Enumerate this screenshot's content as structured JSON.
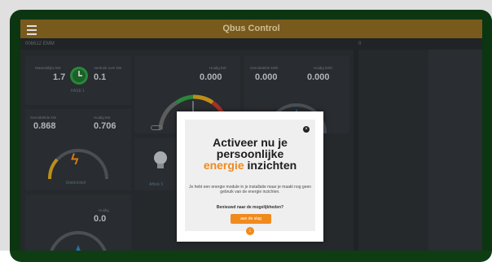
{
  "colors": {
    "accent": "#f08a1c",
    "topbar": "#8a6722",
    "frame": "#0e3d14",
    "app_bg": "#2c2f33"
  },
  "header": {
    "title": "Qbus Control",
    "menu_icon": "menu-icon"
  },
  "subbar": {
    "device": "006612 EMM",
    "right_id": "0"
  },
  "widgets": {
    "w1": {
      "label_a": "Maandelijks kW",
      "value_a": "1.7",
      "label_b": "Verbruik over kW",
      "value_b": "0.1",
      "phase": "FASE 1",
      "icon": "clock-icon"
    },
    "w2": {
      "label": "Huidig kW",
      "value": "0.000"
    },
    "w3": {
      "label_a": "Gemiddelde kWh",
      "value_a": "0.000",
      "label_b": "Huidig kWh",
      "value_b": "0.000"
    },
    "w4": {
      "label_a": "Gemiddelde kW",
      "value_a": "0.868",
      "label_b": "Huidig kW",
      "value_b": "0.706",
      "caption": "Elektriciteit",
      "icon": "lightning-icon"
    },
    "w5": {
      "caption": "Aftrek 5",
      "icon": "bulb-icon"
    },
    "w6": {
      "label": "Huidig",
      "value": "0.0"
    }
  },
  "modal": {
    "close_icon": "close-icon",
    "title_line1": "Activeer nu je",
    "title_line2": "persoonlijke",
    "title_orange": "energie",
    "title_rest": " inzichten",
    "body": "Je hebt een energie module in je installatie maar je maakt nog geen gebruik van de energie inzichten.",
    "question": "Benieuwd naar de mogelijkheden?",
    "cta": "aan de slag",
    "bottom_icon": "arrow-down-icon"
  }
}
